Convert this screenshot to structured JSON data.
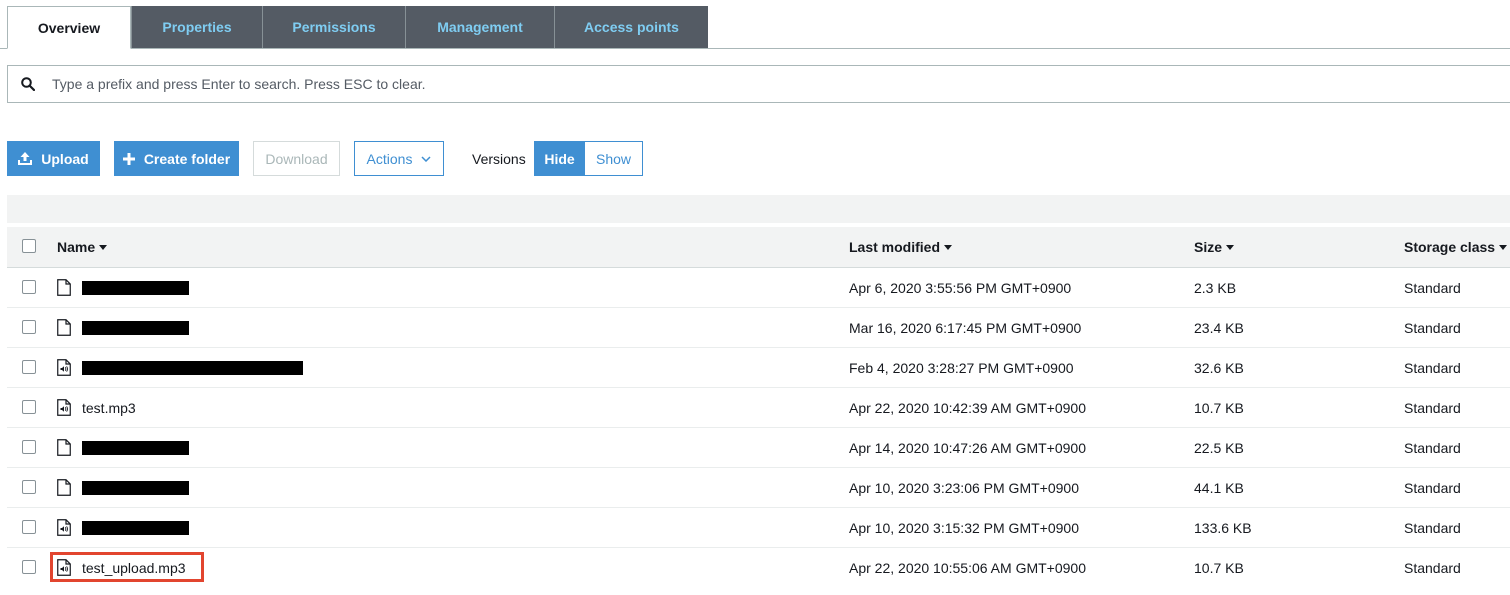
{
  "tabs": [
    {
      "label": "Overview",
      "active": true
    },
    {
      "label": "Properties",
      "active": false
    },
    {
      "label": "Permissions",
      "active": false
    },
    {
      "label": "Management",
      "active": false
    },
    {
      "label": "Access points",
      "active": false
    }
  ],
  "search": {
    "placeholder": "Type a prefix and press Enter to search. Press ESC to clear.",
    "icon": "search-icon"
  },
  "toolbar": {
    "upload_label": "Upload",
    "create_folder_label": "Create folder",
    "download_label": "Download",
    "actions_label": "Actions",
    "versions_label": "Versions",
    "hide_label": "Hide",
    "show_label": "Show"
  },
  "table": {
    "columns": {
      "name": "Name",
      "last_modified": "Last modified",
      "size": "Size",
      "storage_class": "Storage class"
    },
    "rows": [
      {
        "name": "",
        "redacted": true,
        "icon": "file-icon",
        "last_modified": "Apr 6, 2020 3:55:56 PM GMT+0900",
        "size": "2.3 KB",
        "storage_class": "Standard"
      },
      {
        "name": "",
        "redacted": true,
        "icon": "file-icon",
        "last_modified": "Mar 16, 2020 6:17:45 PM GMT+0900",
        "size": "23.4 KB",
        "storage_class": "Standard"
      },
      {
        "name": "",
        "redacted": true,
        "icon": "audio-file-icon",
        "last_modified": "Feb 4, 2020 3:28:27 PM GMT+0900",
        "size": "32.6 KB",
        "storage_class": "Standard"
      },
      {
        "name": "test.mp3",
        "redacted": false,
        "icon": "audio-file-icon",
        "last_modified": "Apr 22, 2020 10:42:39 AM GMT+0900",
        "size": "10.7 KB",
        "storage_class": "Standard"
      },
      {
        "name": "",
        "redacted": true,
        "icon": "file-icon",
        "last_modified": "Apr 14, 2020 10:47:26 AM GMT+0900",
        "size": "22.5 KB",
        "storage_class": "Standard"
      },
      {
        "name": "",
        "redacted": true,
        "icon": "file-icon",
        "last_modified": "Apr 10, 2020 3:23:06 PM GMT+0900",
        "size": "44.1 KB",
        "storage_class": "Standard"
      },
      {
        "name": "",
        "redacted": true,
        "icon": "audio-file-icon",
        "last_modified": "Apr 10, 2020 3:15:32 PM GMT+0900",
        "size": "133.6 KB",
        "storage_class": "Standard"
      },
      {
        "name": "test_upload.mp3",
        "redacted": false,
        "highlighted": true,
        "icon": "audio-file-icon",
        "last_modified": "Apr 22, 2020 10:55:06 AM GMT+0900",
        "size": "10.7 KB",
        "storage_class": "Standard"
      }
    ]
  },
  "colors": {
    "primary": "#3f8fd2",
    "tab_bg": "#545b64",
    "tab_text": "#7fcdf2",
    "highlight": "#e2452f"
  }
}
